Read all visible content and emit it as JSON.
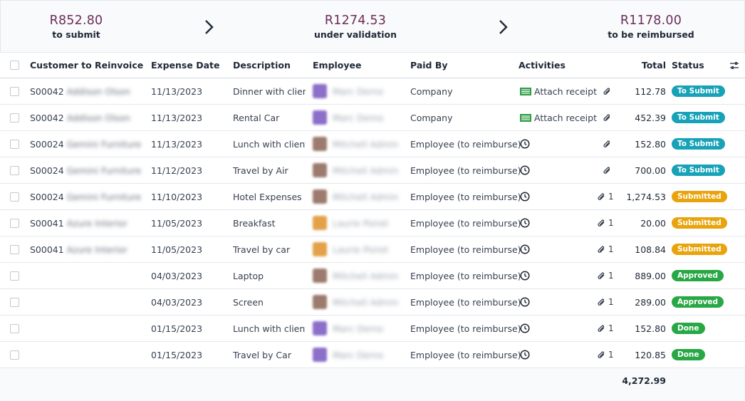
{
  "summary": {
    "to_submit": {
      "amount": "R852.80",
      "label": "to submit"
    },
    "under_validation": {
      "amount": "R1274.53",
      "label": "under validation"
    },
    "to_be_reimbursed": {
      "amount": "R1178.00",
      "label": "to be reimbursed"
    }
  },
  "columns": {
    "customer": "Customer to Reinvoice",
    "date": "Expense Date",
    "description": "Description",
    "employee": "Employee",
    "paid_by": "Paid By",
    "activities": "Activities",
    "total": "Total",
    "status": "Status"
  },
  "colors": {
    "summary_amount": "#6b2d5c",
    "badge_to_submit": "#17a2b8",
    "badge_submitted": "#e9a30c",
    "badge_approved": "#28a745",
    "badge_done": "#28a745",
    "attach_receipt_icon": "#2e9d45"
  },
  "icons": {
    "arrow": "chevron-right-icon",
    "settings": "optional-columns-icon",
    "attach": "receipt-icon",
    "activity": "clock-icon",
    "attachment": "paperclip-icon"
  },
  "rows": [
    {
      "customer": "S00042",
      "customer_name": "Addison Olson",
      "date": "11/13/2023",
      "description": "Dinner with client",
      "employee": "Marc Demo",
      "avatar": "#8b6fc9",
      "paid_by": "Company",
      "activity": "Attach receipt",
      "attachments": "",
      "total": "112.78",
      "status": "To Submit",
      "status_class": "b-submit"
    },
    {
      "customer": "S00042",
      "customer_name": "Addison Olson",
      "date": "11/13/2023",
      "description": "Rental Car",
      "employee": "Marc Demo",
      "avatar": "#8b6fc9",
      "paid_by": "Company",
      "activity": "Attach receipt",
      "attachments": "",
      "total": "452.39",
      "status": "To Submit",
      "status_class": "b-submit"
    },
    {
      "customer": "S00024",
      "customer_name": "Gemini Furniture",
      "date": "11/13/2023",
      "description": "Lunch with client",
      "employee": "Mitchell Admin",
      "avatar": "#9c7b6e",
      "paid_by": "Employee (to reimburse)",
      "activity": "",
      "attachments": "",
      "total": "152.80",
      "status": "To Submit",
      "status_class": "b-submit"
    },
    {
      "customer": "S00024",
      "customer_name": "Gemini Furniture",
      "date": "11/12/2023",
      "description": "Travel by Air",
      "employee": "Mitchell Admin",
      "avatar": "#9c7b6e",
      "paid_by": "Employee (to reimburse)",
      "activity": "",
      "attachments": "",
      "total": "700.00",
      "status": "To Submit",
      "status_class": "b-submit"
    },
    {
      "customer": "S00024",
      "customer_name": "Gemini Furniture",
      "date": "11/10/2023",
      "description": "Hotel Expenses",
      "employee": "Mitchell Admin",
      "avatar": "#9c7b6e",
      "paid_by": "Employee (to reimburse)",
      "activity": "",
      "attachments": "1",
      "total": "1,274.53",
      "status": "Submitted",
      "status_class": "b-submitted"
    },
    {
      "customer": "S00041",
      "customer_name": "Azure Interior",
      "date": "11/05/2023",
      "description": "Breakfast",
      "employee": "Laurie Poiret",
      "avatar": "#e3a14a",
      "paid_by": "Employee (to reimburse)",
      "activity": "",
      "attachments": "1",
      "total": "20.00",
      "status": "Submitted",
      "status_class": "b-submitted"
    },
    {
      "customer": "S00041",
      "customer_name": "Azure Interior",
      "date": "11/05/2023",
      "description": "Travel by car",
      "employee": "Laurie Poiret",
      "avatar": "#e3a14a",
      "paid_by": "Employee (to reimburse)",
      "activity": "",
      "attachments": "1",
      "total": "108.84",
      "status": "Submitted",
      "status_class": "b-submitted"
    },
    {
      "customer": "",
      "customer_name": "",
      "date": "04/03/2023",
      "description": "Laptop",
      "employee": "Mitchell Admin",
      "avatar": "#9c7b6e",
      "paid_by": "Employee (to reimburse)",
      "activity": "",
      "attachments": "1",
      "total": "889.00",
      "status": "Approved",
      "status_class": "b-approved"
    },
    {
      "customer": "",
      "customer_name": "",
      "date": "04/03/2023",
      "description": "Screen",
      "employee": "Mitchell Admin",
      "avatar": "#9c7b6e",
      "paid_by": "Employee (to reimburse)",
      "activity": "",
      "attachments": "1",
      "total": "289.00",
      "status": "Approved",
      "status_class": "b-approved"
    },
    {
      "customer": "",
      "customer_name": "",
      "date": "01/15/2023",
      "description": "Lunch with client",
      "employee": "Marc Demo",
      "avatar": "#8b6fc9",
      "paid_by": "Employee (to reimburse)",
      "activity": "",
      "attachments": "1",
      "total": "152.80",
      "status": "Done",
      "status_class": "b-done"
    },
    {
      "customer": "",
      "customer_name": "",
      "date": "01/15/2023",
      "description": "Travel by Car",
      "employee": "Marc Demo",
      "avatar": "#8b6fc9",
      "paid_by": "Employee (to reimburse)",
      "activity": "",
      "attachments": "1",
      "total": "120.85",
      "status": "Done",
      "status_class": "b-done"
    }
  ],
  "footer": {
    "grand_total": "4,272.99"
  }
}
